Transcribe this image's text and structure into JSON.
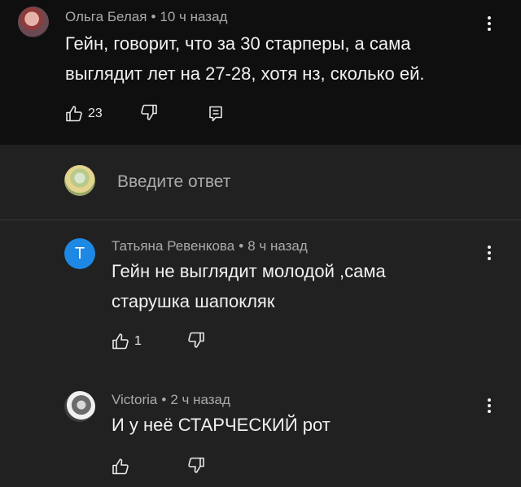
{
  "comments": [
    {
      "author": "Ольга Белая",
      "time": "10 ч назад",
      "lines": [
        "Гейн, говорит, что за 30 старперы, а сама",
        "выглядит лет на 27-28, хотя нз, сколько ей."
      ],
      "likes": "23"
    },
    {
      "author": "Татьяна Ревенкова",
      "time": "8 ч назад",
      "avatar_letter": "Т",
      "avatar_color": "#1e88e5",
      "lines": [
        "Гейн не выглядит молодой ,сама",
        "старушка шапокляк"
      ],
      "likes": "1"
    },
    {
      "author": "Victoria",
      "time": "2 ч назад",
      "lines": [
        "И у неё СТАРЧЕСКИЙ рот"
      ],
      "likes": ""
    }
  ],
  "reply": {
    "placeholder": "Введите ответ"
  },
  "separator": "•",
  "icons": {
    "like": "thumb-up-icon",
    "dislike": "thumb-down-icon",
    "reply": "comment-reply-icon",
    "more": "more-vert-icon"
  },
  "colors": {
    "background": "#212121",
    "highlighted_comment_bg": "#0f0f0f",
    "text_primary": "#f1f1f1",
    "text_secondary": "#aaaaaa"
  }
}
